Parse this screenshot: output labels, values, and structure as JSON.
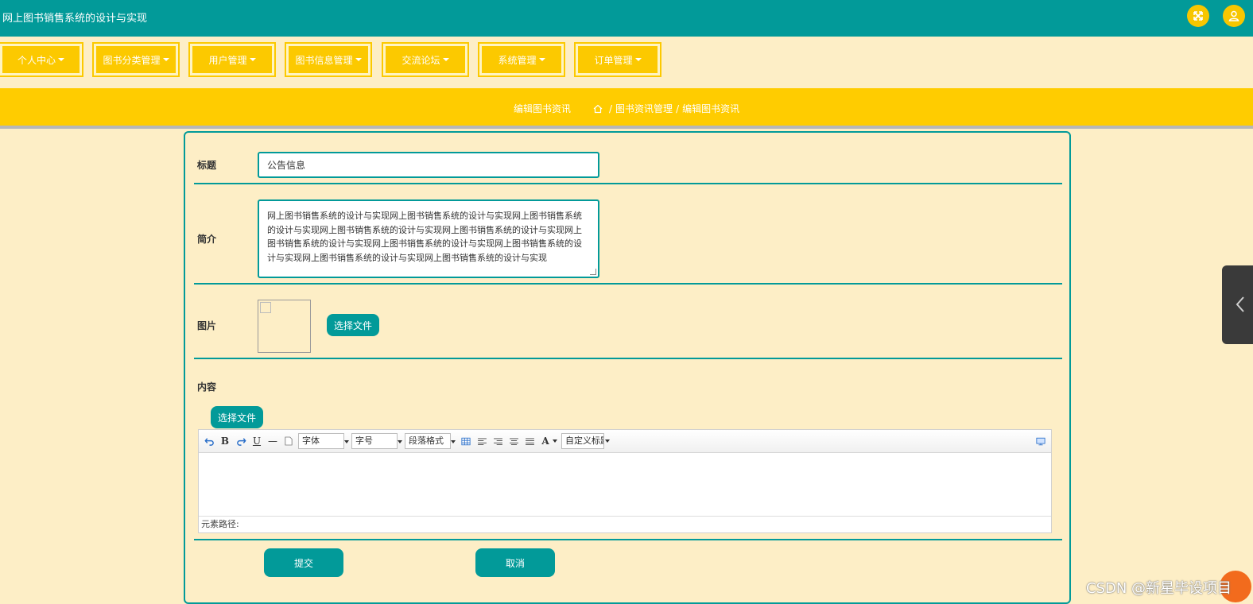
{
  "header": {
    "app_title": "网上图书销售系统的设计与实现"
  },
  "nav": {
    "items": [
      {
        "label": "个人中心"
      },
      {
        "label": "图书分类管理"
      },
      {
        "label": "用户管理"
      },
      {
        "label": "图书信息管理"
      },
      {
        "label": "交流论坛"
      },
      {
        "label": "系统管理"
      },
      {
        "label": "订单管理"
      }
    ]
  },
  "breadcrumb": {
    "page_title": "编辑图书资讯",
    "path": [
      "图书资讯管理",
      "编辑图书资讯"
    ],
    "separator": "/"
  },
  "form": {
    "title_label": "标题",
    "title_value": "公告信息",
    "intro_label": "简介",
    "intro_value": "网上图书销售系统的设计与实现网上图书销售系统的设计与实现网上图书销售系统的设计与实现网上图书销售系统的设计与实现网上图书销售系统的设计与实现网上图书销售系统的设计与实现网上图书销售系统的设计与实现网上图书销售系统的设计与实现网上图书销售系统的设计与实现网上图书销售系统的设计与实现",
    "image_label": "图片",
    "choose_file_label": "选择文件",
    "content_label": "内容",
    "content_choose_file_label": "选择文件",
    "submit_label": "提交",
    "cancel_label": "取消"
  },
  "editor": {
    "font_family": "字体",
    "font_size": "字号",
    "paragraph": "段落格式",
    "custom_title": "自定义标题",
    "element_path": "元素路径:"
  },
  "watermark": "CSDN @新星毕设项目",
  "colors": {
    "primary": "#029a99",
    "accent": "#fcc900",
    "background": "#fdeec6"
  }
}
